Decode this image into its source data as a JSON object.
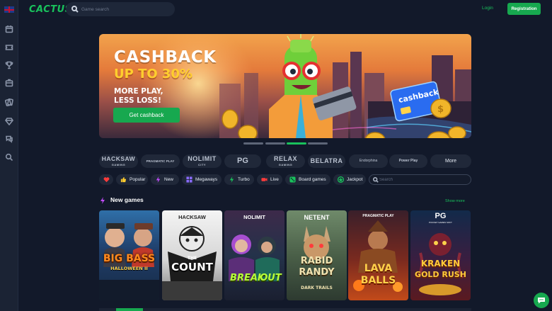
{
  "header": {
    "logo_text": "CACTUS",
    "search_placeholder": "Game search",
    "login_label": "Login",
    "register_label": "Registration"
  },
  "sidebar": {
    "icons": [
      "flag-icon",
      "calendar-icon",
      "ticket-icon",
      "trophy-icon",
      "box-icon",
      "cards-icon",
      "diamond-icon",
      "chat-bubbles-icon",
      "search-icon"
    ]
  },
  "banner": {
    "title": "CASHBACK",
    "subtitle": "UP TO 30%",
    "line1": "MORE PLAY,",
    "line2": "LESS LOSS!",
    "cta_label": "Get cashback",
    "card_text": "cashback",
    "active_slide": 3,
    "slide_count": 4
  },
  "providers": [
    {
      "name": "HACKSAW",
      "sub": "GAMING"
    },
    {
      "name": "PRAGMATIC PLAY",
      "sub": ""
    },
    {
      "name": "NOLIMIT",
      "sub": "CITY"
    },
    {
      "name": "PG",
      "sub": ""
    },
    {
      "name": "RELAX",
      "sub": "GAMING"
    },
    {
      "name": "BELATRA",
      "sub": ""
    },
    {
      "name": "Endorphina",
      "sub": ""
    },
    {
      "name": "Power Play",
      "sub": ""
    },
    {
      "name": "More",
      "sub": ""
    }
  ],
  "categories": [
    {
      "label": "",
      "icon": "heart-icon"
    },
    {
      "label": "Popular",
      "icon": "thumbs-up-icon"
    },
    {
      "label": "New",
      "icon": "lightning-icon"
    },
    {
      "label": "Megaways",
      "icon": "grid-icon"
    },
    {
      "label": "Turbo",
      "icon": "lightning-icon"
    },
    {
      "label": "Live",
      "icon": "camera-icon"
    },
    {
      "label": "Board games",
      "icon": "dice-icon"
    },
    {
      "label": "Jackpot",
      "icon": "jackpot-icon"
    }
  ],
  "category_search_placeholder": "Search",
  "new_games": {
    "title": "New games",
    "show_more": "Show more",
    "games": [
      {
        "provider": "",
        "title": "BIG BASS",
        "title2": "HALLOWEEN II"
      },
      {
        "provider": "HACKSAW",
        "title": "THE",
        "title2": "COUNT"
      },
      {
        "provider": "NOLIMIT",
        "title": "BREAK",
        "title2": "OUT"
      },
      {
        "provider": "NETENT",
        "title": "RABID",
        "title2": "RANDY",
        "title3": "DARK TRAILS"
      },
      {
        "provider": "PRAGMATIC PLAY",
        "title": "LAVA",
        "title2": "BALLS"
      },
      {
        "provider": "PG",
        "title": "KRAKEN",
        "title2": "GOLD RUSH",
        "sub": "POCKET GAMES SOFT"
      }
    ]
  },
  "colors": {
    "background": "#12192a",
    "accent": "#19c15c",
    "button": "#17a84f",
    "chip": "#202839"
  }
}
